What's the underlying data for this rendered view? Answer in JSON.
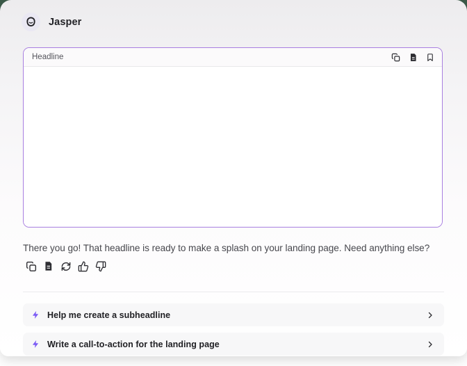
{
  "page": {
    "backdrop_color": "#3c5b49",
    "accent_purple": "#7b5bf5",
    "output_border_purple": "#a87fe0"
  },
  "header": {
    "app_name": "Jasper",
    "avatar_icon": "jasper-logo-icon"
  },
  "output_box": {
    "title": "Headline",
    "content": "",
    "toolbar_icons": [
      "copy-icon",
      "document-icon",
      "bookmark-icon"
    ]
  },
  "assistant_message": {
    "text": "There you go! That headline is ready to make a splash on your landing page. Need anything else?",
    "action_icons": [
      "copy-icon",
      "document-icon",
      "regenerate-icon",
      "thumbs-up-icon",
      "thumbs-down-icon"
    ]
  },
  "suggestions": [
    {
      "label": "Help me create a subheadline",
      "leading_icon": "lightning-icon",
      "trailing_icon": "chevron-right-icon"
    },
    {
      "label": "Write a call-to-action for the landing page",
      "leading_icon": "lightning-icon",
      "trailing_icon": "chevron-right-icon"
    }
  ]
}
